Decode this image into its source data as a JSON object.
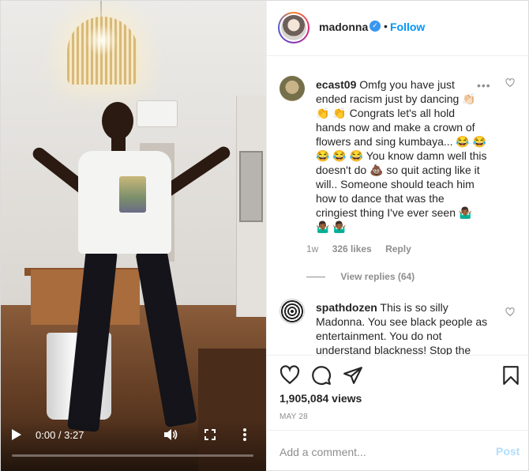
{
  "video": {
    "time": "0:00 / 3:27",
    "progress": 0
  },
  "header": {
    "username": "madonna",
    "verified_glyph": "✓",
    "separator": "•",
    "follow_label": "Follow"
  },
  "comments": [
    {
      "username": "ecast09",
      "text": "Omfg you have just ended racism just by dancing 👏🏻 👏 👏 Congrats let's all hold hands now and make a crown of flowers and sing kumbaya... 😂 😂 😂 😂 😂 You know damn well this doesn't do 💩 so quit acting like it will.. Someone should teach him how to dance that was the cringiest thing I've ever seen 🤷🏾‍♂️ 🤷🏾‍♂️ 🤷🏾‍♂️",
      "more": "•••",
      "time": "1w",
      "likes": "326 likes",
      "reply_label": "Reply",
      "view_replies": "View replies (64)"
    },
    {
      "username": "spathdozen",
      "text": "This is so silly Madonna. You see black people as entertainment. You do not understand blackness! Stop the"
    }
  ],
  "actions": {
    "views": "1,905,084 views",
    "date": "MAY 28"
  },
  "add_comment": {
    "placeholder": "Add a comment...",
    "post_label": "Post"
  },
  "icons": [
    "play-icon",
    "volume-icon",
    "fullscreen-icon",
    "more-vertical-icon",
    "verified-icon",
    "more-horizontal-icon",
    "heart-icon",
    "comment-icon",
    "share-icon",
    "bookmark-icon"
  ],
  "colors": {
    "link": "#0095f6",
    "verified": "#3897f0",
    "muted": "#8e8e8e",
    "post_disabled": "#b2dffc"
  }
}
